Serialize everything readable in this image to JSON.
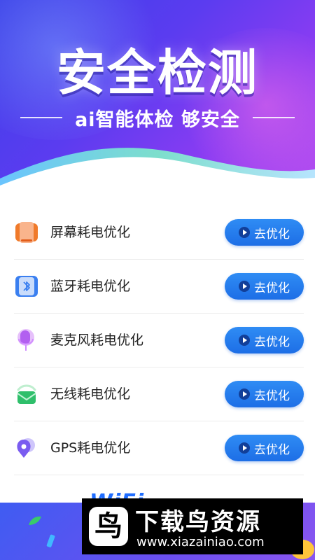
{
  "hero": {
    "title": "安全检测",
    "subtitle": "ai智能体检 够安全"
  },
  "items": [
    {
      "label": "屏幕耗电优化",
      "button": "去优化",
      "icon": "screen-icon"
    },
    {
      "label": "蓝牙耗电优化",
      "button": "去优化",
      "icon": "bluetooth-icon"
    },
    {
      "label": "麦克风耗电优化",
      "button": "去优化",
      "icon": "microphone-icon"
    },
    {
      "label": "无线耗电优化",
      "button": "去优化",
      "icon": "wifi-icon"
    },
    {
      "label": "GPS耗电优化",
      "button": "去优化",
      "icon": "gps-icon"
    }
  ],
  "banner": {
    "partial_text": "WiFi"
  },
  "watermark": {
    "name": "下载鸟资源",
    "url": "www.xiazainiao.com"
  },
  "colors": {
    "button": "#1f72e8",
    "hero_start": "#3b40e8",
    "hero_end": "#b84ef0"
  }
}
